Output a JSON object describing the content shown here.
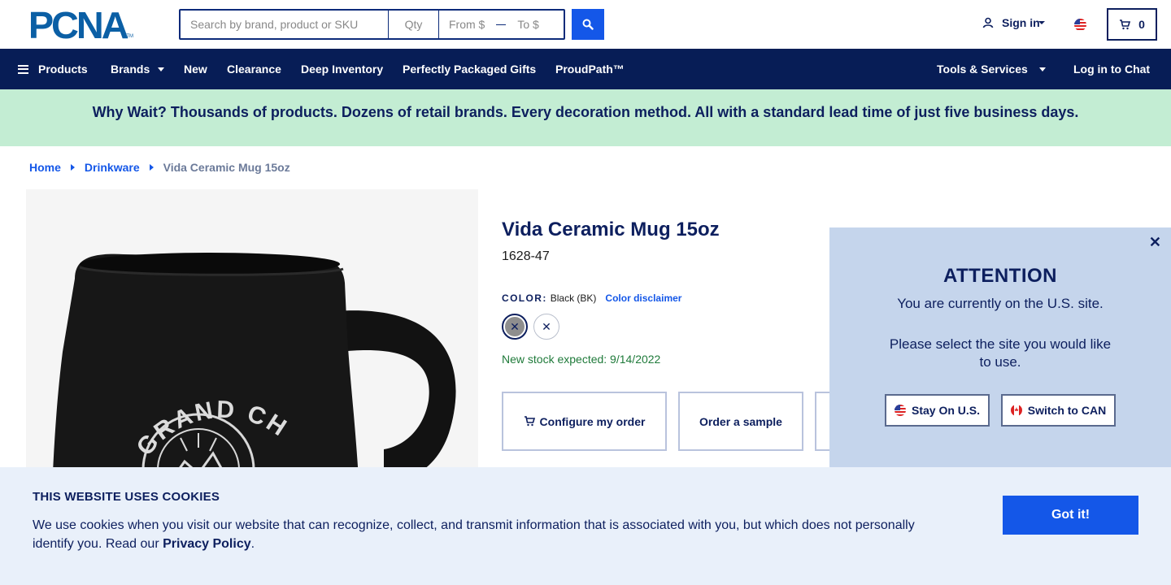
{
  "header": {
    "logo_text": "PCNA",
    "logo_tm": "TM",
    "search_placeholder": "Search by brand, product or SKU",
    "qty_placeholder": "Qty",
    "from_placeholder": "From $",
    "to_placeholder": "To $",
    "search_icon": "search-icon",
    "sign_in": "Sign in",
    "cart_count": "0",
    "brand_color": "#0b5fa5",
    "accent_color": "#1457e8"
  },
  "nav": {
    "products": "Products",
    "brands": "Brands",
    "new": "New",
    "clearance": "Clearance",
    "deep_inventory": "Deep Inventory",
    "gifts": "Perfectly Packaged Gifts",
    "proudpath": "ProudPath™",
    "tools": "Tools & Services",
    "chat": "Log in to Chat",
    "bg_color": "#071d56"
  },
  "banner": {
    "text": "Why Wait? Thousands of products. Dozens of retail brands. Every decoration method. All with a standard lead time of just five business days.",
    "bg_color": "#c3edd3"
  },
  "breadcrumb": {
    "home": "Home",
    "category": "Drinkware",
    "current": "Vida Ceramic Mug 15oz"
  },
  "product": {
    "title": "Vida Ceramic Mug 15oz",
    "sku": "1628-47",
    "color_label": "COLOR:",
    "color_value": "Black (BK)",
    "color_disclaimer": "Color disclaimer",
    "stock_text": "New stock expected: 9/14/2022",
    "configure_btn": "Configure my order",
    "sample_btn": "Order a sample",
    "mug_text": "GRAND CHIEF"
  },
  "popup": {
    "title": "ATTENTION",
    "message1": "You are currently on the U.S. site.",
    "message2": "Please select the site you would like to use.",
    "stay_btn": "Stay On U.S.",
    "switch_btn": "Switch to CAN",
    "close": "✕"
  },
  "cookie": {
    "title": "THIS WEBSITE USES COOKIES",
    "text": "We use cookies when you visit our website that can recognize, collect, and transmit information that is associated with you, but which does not personally identify you. Read our ",
    "link": "Privacy Policy",
    "suffix": ".",
    "button": "Got it!"
  }
}
